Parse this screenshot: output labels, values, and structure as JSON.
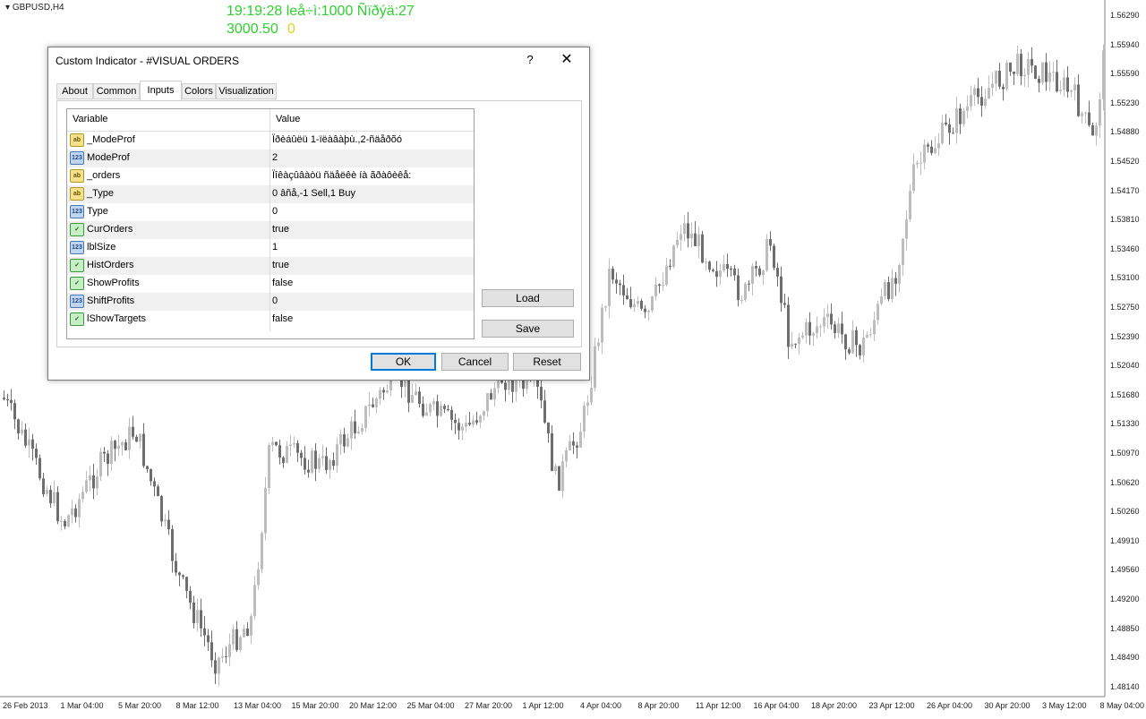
{
  "chart": {
    "symbol": "GBPUSD,H4",
    "clock_line": "19:19:28 leå÷ì:1000 Ñïðýä:27",
    "value_main": "3000.50",
    "value_second": "0",
    "price_ticks": [
      "1.56290",
      "1.55940",
      "1.55590",
      "1.55230",
      "1.54880",
      "1.54520",
      "1.54170",
      "1.53810",
      "1.53460",
      "1.53100",
      "1.52750",
      "1.52390",
      "1.52040",
      "1.51680",
      "1.51330",
      "1.50970",
      "1.50620",
      "1.50260",
      "1.49910",
      "1.49560",
      "1.49200",
      "1.48850",
      "1.48490",
      "1.48140"
    ],
    "time_ticks": [
      "26 Feb 2013",
      "1 Mar 04:00",
      "5 Mar 20:00",
      "8 Mar 12:00",
      "13 Mar 04:00",
      "15 Mar 20:00",
      "20 Mar 12:00",
      "25 Mar 04:00",
      "27 Mar 20:00",
      "1 Apr 12:00",
      "4 Apr 04:00",
      "8 Apr 20:00",
      "11 Apr 12:00",
      "16 Apr 04:00",
      "18 Apr 20:00",
      "23 Apr 12:00",
      "26 Apr 04:00",
      "30 Apr 20:00",
      "3 May 12:00",
      "8 May 04:00"
    ],
    "colors": {
      "bull": "#bdbdbd",
      "bear": "#6e6e6e",
      "clock": "#2ed12e",
      "yellow": "#e6d21c"
    }
  },
  "dialog": {
    "title": "Custom Indicator - #VISUAL ORDERS",
    "help": "?",
    "close": "✕",
    "tabs": [
      "About",
      "Common",
      "Inputs",
      "Colors",
      "Visualization"
    ],
    "active_tab": "Inputs",
    "columns": {
      "variable": "Variable",
      "value": "Value"
    },
    "rows": [
      {
        "type": "str",
        "icon": "ab",
        "variable": "_ModeProf",
        "value": "Ïðèáûëü 1-ïëàâàþù.,2-ñäåðõó"
      },
      {
        "type": "num",
        "icon": "123",
        "variable": "ModeProf",
        "value": "2"
      },
      {
        "type": "str",
        "icon": "ab",
        "variable": "_orders",
        "value": "Ïîêàçûâàòü ñäåëêè íà ãðàôèêå:"
      },
      {
        "type": "str",
        "icon": "ab",
        "variable": "_Type",
        "value": "0 âñå,-1 Sell,1 Buy"
      },
      {
        "type": "num",
        "icon": "123",
        "variable": "Type",
        "value": "0"
      },
      {
        "type": "bool",
        "icon": "✓",
        "variable": "CurOrders",
        "value": "true"
      },
      {
        "type": "num",
        "icon": "123",
        "variable": "lblSize",
        "value": "1"
      },
      {
        "type": "bool",
        "icon": "✓",
        "variable": "HistOrders",
        "value": "true"
      },
      {
        "type": "bool",
        "icon": "✓",
        "variable": "ShowProfits",
        "value": "false"
      },
      {
        "type": "num",
        "icon": "123",
        "variable": "ShiftProfits",
        "value": "0"
      },
      {
        "type": "bool",
        "icon": "✓",
        "variable": "lShowTargets",
        "value": "false"
      }
    ],
    "buttons": {
      "load": "Load",
      "save": "Save",
      "ok": "OK",
      "cancel": "Cancel",
      "reset": "Reset"
    }
  }
}
